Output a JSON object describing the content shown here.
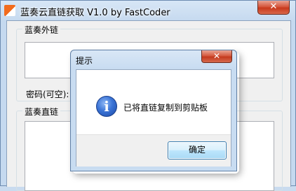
{
  "window": {
    "title": "蓝奏云直链获取 V1.0 by FastCoder",
    "close_glyph": "✕"
  },
  "groups": {
    "external_link_label": "蓝奏外链",
    "password_label": "密码(可空):",
    "direct_link_label": "蓝奏直链"
  },
  "dialog": {
    "title": "提示",
    "close_glyph": "✕",
    "icon": "information-icon",
    "icon_glyph": "i",
    "message": "已将直链复制到剪贴板",
    "ok_label": "确定"
  },
  "colors": {
    "title_bar": "#c5d9ef",
    "close_button": "#c8391c",
    "app_icon": "#f26b1d",
    "info_icon": "#3b74d6"
  }
}
